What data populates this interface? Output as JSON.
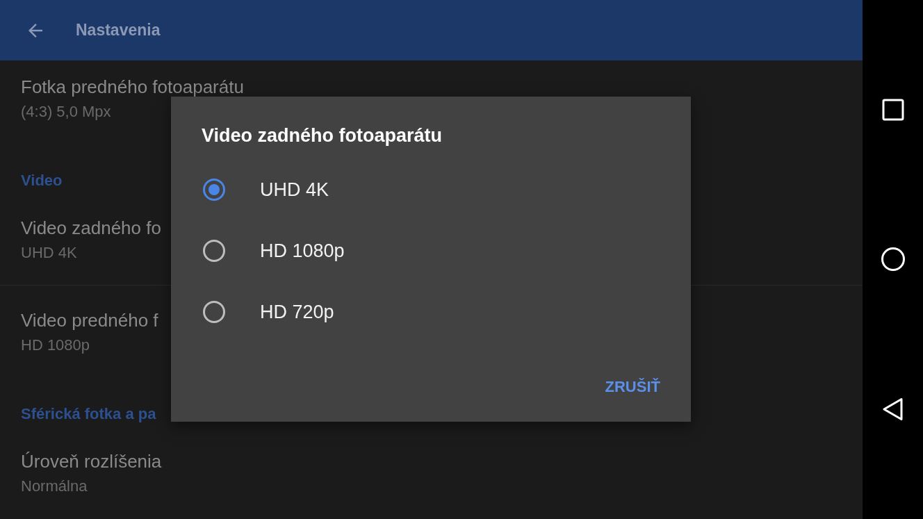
{
  "app_bar": {
    "title": "Nastavenia"
  },
  "sections": [
    {
      "items": [
        {
          "title": "Fotka predného fotoaparátu",
          "summary": "(4:3) 5,0 Mpx"
        }
      ]
    },
    {
      "header": "Video",
      "items": [
        {
          "title": "Video zadného fo",
          "summary": "UHD 4K"
        },
        {
          "title": "Video predného f",
          "summary": "HD 1080p"
        }
      ]
    },
    {
      "header": "Sférická fotka a pa",
      "items": [
        {
          "title": "Úroveň rozlíšenia",
          "summary": "Normálna"
        }
      ]
    }
  ],
  "dialog": {
    "title": "Video zadného fotoaparátu",
    "options": [
      {
        "label": "UHD 4K",
        "selected": true
      },
      {
        "label": "HD 1080p",
        "selected": false
      },
      {
        "label": "HD 720p",
        "selected": false
      }
    ],
    "buttons": [
      "ZRUŠIŤ"
    ]
  }
}
